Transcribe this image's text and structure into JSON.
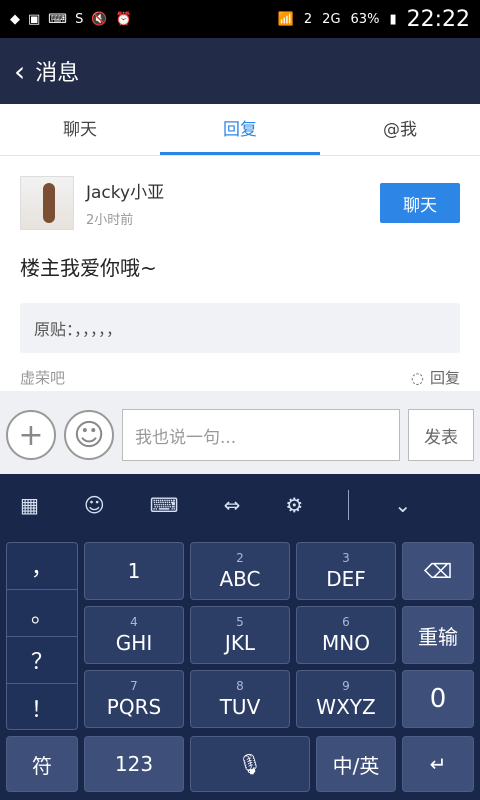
{
  "status": {
    "time": "22:22",
    "battery": "63%",
    "sim": "2",
    "net": "2G"
  },
  "header": {
    "title": "消息"
  },
  "tabs": [
    {
      "label": "聊天"
    },
    {
      "label": "回复"
    },
    {
      "label": "@我"
    }
  ],
  "post": {
    "user": "Jacky小亚",
    "time": "2小时前",
    "chat": "聊天",
    "message": "楼主我爱你哦~",
    "quote": "原贴：，，，，，",
    "forum": "虚荣吧",
    "reply": "回复"
  },
  "input": {
    "placeholder": "我也说一句...",
    "send": "发表"
  },
  "keyboard": {
    "punct": [
      "，",
      "。",
      "？",
      "！"
    ],
    "keys": {
      "k1": "1",
      "k2": "ABC",
      "k3": "DEF",
      "k4": "GHI",
      "k5": "JKL",
      "k6": "MNO",
      "k7": "PQRS",
      "k8": "TUV",
      "k9": "WXYZ",
      "d2": "2",
      "d3": "3",
      "d4": "4",
      "d5": "5",
      "d6": "6",
      "d7": "7",
      "d8": "8",
      "d9": "9"
    },
    "relead": "重输",
    "zero": "0",
    "sym": "符",
    "num": "123",
    "lang": "中/英"
  }
}
